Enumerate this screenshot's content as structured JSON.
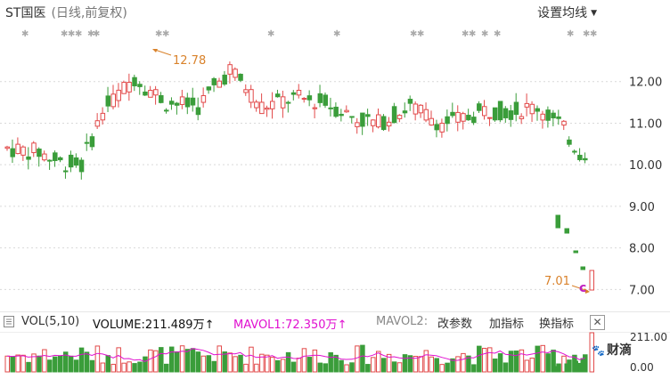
{
  "header": {
    "stock_name": "ST国医",
    "chart_mode": "(日线,前复权)",
    "settings_label": "设置均线",
    "settings_caret": "▼"
  },
  "price_axis": {
    "labels": [
      "12.00",
      "11.00",
      "10.00",
      "9.00",
      "8.00",
      "7.00"
    ],
    "values": [
      12,
      11,
      10,
      9,
      8,
      7
    ],
    "min": 6.6,
    "max": 13.45
  },
  "annotations": {
    "high_label": "12.78",
    "high_value": 12.78,
    "low_label": "7.01",
    "low_value": 7.01,
    "c_marker": "c",
    "star_glyph": "✱"
  },
  "colors": {
    "up": "#e24a4a",
    "down": "#3a9d3a",
    "annotation": "#d9822b",
    "mavol1": "#e010d0",
    "grid": "#d9d9d9",
    "star": "#aaaaaa"
  },
  "volume_bar": {
    "vol_label": "VOL(5,10)",
    "volume_label": "VOLUME:211.489万",
    "volume_arrow": "↑",
    "mavol1_label": "MAVOL1:72.350万",
    "mavol1_arrow": "↑",
    "mavol2_label": "MAVOL2:",
    "btn_params": "改参数",
    "btn_add": "加指标",
    "btn_switch": "换指标",
    "btn_close": "✕"
  },
  "volume_axis": {
    "top_label": "211.00",
    "bottom_label": "0.00"
  },
  "watermark": {
    "paw": "🐾",
    "text": "财滴"
  }
}
